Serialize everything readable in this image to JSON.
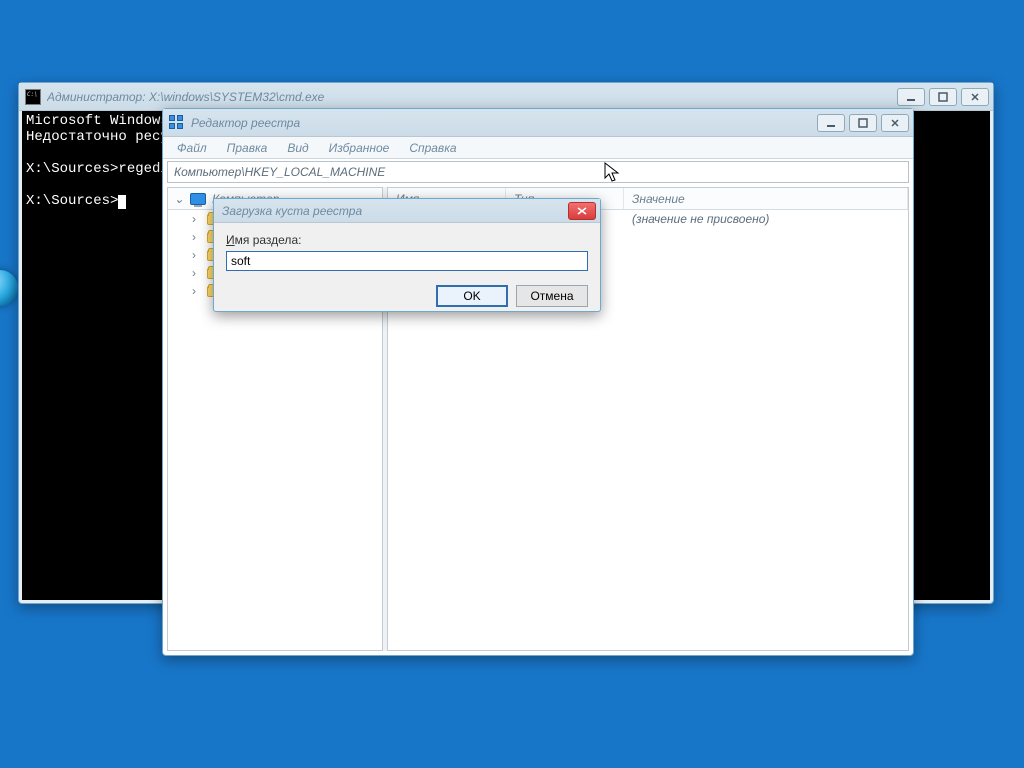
{
  "cmd": {
    "title": "Администратор: X:\\windows\\SYSTEM32\\cmd.exe",
    "line1": "Microsoft Windows",
    "line2": "Недостаточно ресу",
    "prompt1": "X:\\Sources>",
    "cmd1": "regedi",
    "prompt2": "X:\\Sources>"
  },
  "regedit": {
    "title": "Редактор реестра",
    "menu": {
      "file": "Файл",
      "edit": "Правка",
      "view": "Вид",
      "fav": "Избранное",
      "help": "Справка"
    },
    "address": "Компьютер\\HKEY_LOCAL_MACHINE",
    "tree_root": "Компьютер",
    "columns": {
      "name": "Имя",
      "type": "Тип",
      "value": "Значение"
    },
    "default_value": "(значение не присвоено)"
  },
  "dialog": {
    "title": "Загрузка куста реестра",
    "label_prefix": "И",
    "label_rest": "мя раздела:",
    "input_value": "soft",
    "ok": "OK",
    "cancel": "Отмена"
  }
}
